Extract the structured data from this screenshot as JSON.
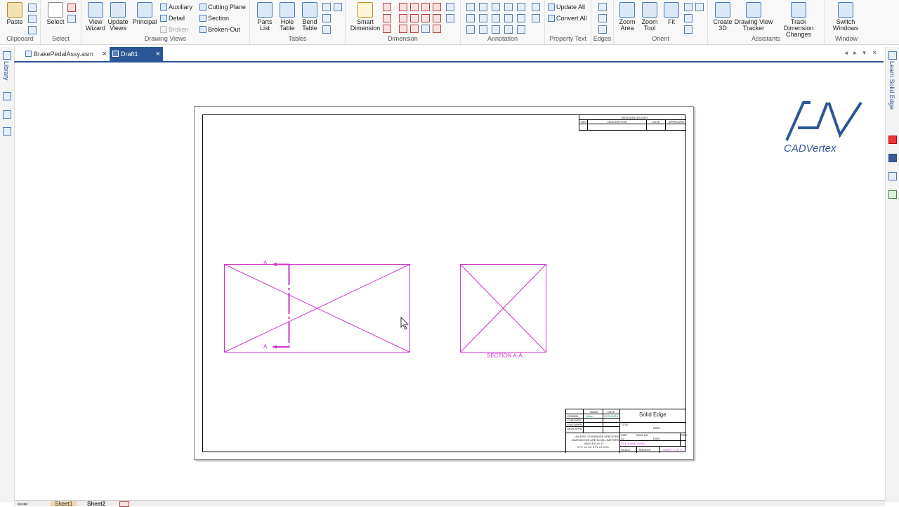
{
  "ribbon": {
    "clipboard": {
      "label": "Clipboard",
      "paste": "Paste"
    },
    "select": {
      "label": "Select",
      "select": "Select"
    },
    "drawing_views": {
      "label": "Drawing Views",
      "view_wizard": "View Wizard",
      "update_views": "Update Views",
      "principal": "Principal",
      "auxiliary": "Auxiliary",
      "detail": "Detail",
      "broken": "Broken",
      "cutting_plane": "Cutting Plane",
      "section": "Section",
      "broken_out": "Broken-Out"
    },
    "tables": {
      "label": "Tables",
      "parts_list": "Parts List",
      "hole_table": "Hole Table",
      "bend_table": "Bend Table"
    },
    "dimension": {
      "label": "Dimension",
      "smart_dimension": "Smart Dimension"
    },
    "annotation": {
      "label": "Annotation"
    },
    "property_text": {
      "label": "Property Text",
      "update_all": "Update All",
      "convert_all": "Convert All"
    },
    "edges": {
      "label": "Edges"
    },
    "orient": {
      "label": "Orient",
      "zoom_area": "Zoom Area",
      "zoom_tool": "Zoom Tool",
      "fit": "Fit"
    },
    "assistants": {
      "label": "Assistants",
      "create_3d": "Create 3D",
      "drawing_view_tracker": "Drawing View Tracker",
      "track_dimension_changes": "Track Dimension Changes"
    },
    "window": {
      "label": "Window",
      "switch_windows": "Switch Windows"
    }
  },
  "tabs": [
    {
      "label": "BrakePedalAssy.asm",
      "close": "×"
    },
    {
      "label": "Draft1",
      "close": "×"
    }
  ],
  "nav_arrows": "◂ ▸ ▾ ✕",
  "sidebar_left": {
    "library": "Library"
  },
  "sidebar_right": {
    "learn": "Learn Solid Edge"
  },
  "drawing": {
    "section_label": "SECTION A-A",
    "cut_letter_top": "A",
    "cut_letter_bottom": "A",
    "revision_history": "REVISION HISTORY",
    "rev": "REV",
    "description": "DESCRIPTION",
    "date": "DATE",
    "approved": "APPROVED",
    "company": "Solid Edge",
    "tb_name": "NAME",
    "tb_date": "DATE",
    "tb_drawn": "DRAWN",
    "tb_drawn_name": "Nutan",
    "tb_drawn_date": "07/01/2019",
    "tb_checked": "CHECKED",
    "tb_eng_appr": "ENG APPR",
    "tb_mgr_appr": "MGR APPR",
    "tb_tolerance_1": "UNLESS OTHERWISE SPECIFIED",
    "tb_tolerance_2": "DIMENSIONS ARE IN MILLIMETERS",
    "tb_tolerance_3": "ANGLES ±X.X°",
    "tb_tolerance_4": "2 PL ±X.XX 3 PL ±X.XXX",
    "tb_title": "TITLE",
    "tb_dwg": "DWG",
    "tb_size": "SIZE",
    "tb_size_val": "A2",
    "tb_dwg_no": "DWG NO",
    "tb_rev": "REV",
    "tb_file_name": "FILE NAME: Draft1",
    "tb_scale": "SCALE:",
    "tb_weight": "WEIGHT:",
    "tb_sheet": "SHEET 2 OF 2"
  },
  "logo_text": "CADVertex",
  "sheet_tabs": {
    "sheet1": "Sheet1",
    "sheet2": "Sheet2"
  },
  "colors": {
    "accent": "#2b5797",
    "view_lines": "#cc33cc"
  }
}
